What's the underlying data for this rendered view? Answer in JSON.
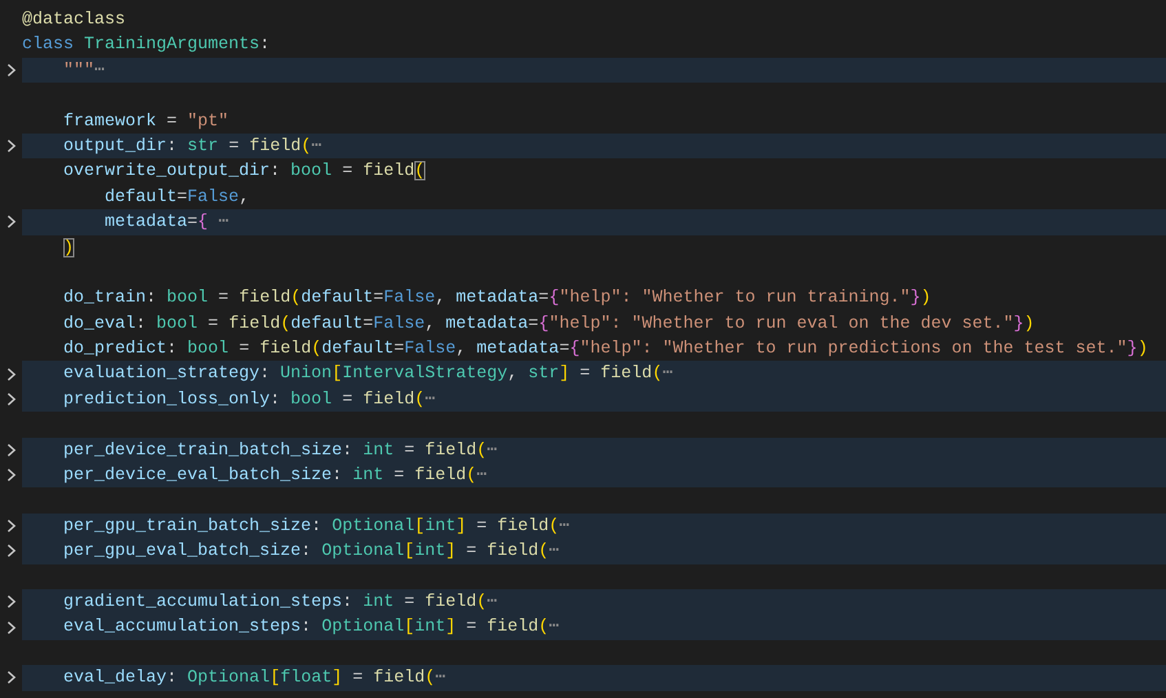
{
  "editor": {
    "blocks": [
      {
        "lines": [
          {
            "folded": false,
            "tokens": [
              {
                "t": "@dataclass",
                "kind": "decorator"
              }
            ]
          },
          {
            "folded": false,
            "tokens": [
              {
                "t": "class ",
                "kind": "keyword"
              },
              {
                "t": "TrainingArguments",
                "kind": "class"
              },
              {
                "t": ":",
                "kind": "plain"
              }
            ]
          },
          {
            "folded": true,
            "tokens": [
              {
                "t": "    \"\"\"",
                "kind": "string"
              },
              {
                "t": "⋯",
                "kind": "fold"
              }
            ]
          }
        ]
      },
      {
        "lines": [
          {
            "folded": false,
            "tokens": [
              {
                "t": "    framework",
                "kind": "var"
              },
              {
                "t": " = ",
                "kind": "plain"
              },
              {
                "t": "\"pt\"",
                "kind": "string"
              }
            ]
          },
          {
            "folded": true,
            "tokens": [
              {
                "t": "    output_dir",
                "kind": "var"
              },
              {
                "t": ": ",
                "kind": "plain"
              },
              {
                "t": "str",
                "kind": "type"
              },
              {
                "t": " = ",
                "kind": "plain"
              },
              {
                "t": "field",
                "kind": "func"
              },
              {
                "t": "(",
                "kind": "bracket1"
              },
              {
                "t": "⋯",
                "kind": "fold"
              }
            ]
          },
          {
            "folded": false,
            "tokens": [
              {
                "t": "    overwrite_output_dir",
                "kind": "var"
              },
              {
                "t": ": ",
                "kind": "plain"
              },
              {
                "t": "bool",
                "kind": "type"
              },
              {
                "t": " = ",
                "kind": "plain"
              },
              {
                "t": "field",
                "kind": "func"
              },
              {
                "t": "(",
                "kind": "bracket1",
                "matched": true
              }
            ]
          },
          {
            "folded": false,
            "tokens": [
              {
                "t": "        default",
                "kind": "var"
              },
              {
                "t": "=",
                "kind": "plain"
              },
              {
                "t": "False",
                "kind": "keyword"
              },
              {
                "t": ",",
                "kind": "plain"
              }
            ]
          },
          {
            "folded": true,
            "tokens": [
              {
                "t": "        metadata",
                "kind": "var"
              },
              {
                "t": "=",
                "kind": "plain"
              },
              {
                "t": "{",
                "kind": "bracket2"
              },
              {
                "t": " ⋯",
                "kind": "fold"
              }
            ]
          },
          {
            "folded": false,
            "tokens": [
              {
                "t": "    )",
                "kind": "bracket1",
                "matched": true
              }
            ]
          }
        ]
      },
      {
        "lines": [
          {
            "folded": false,
            "tokens": [
              {
                "t": "    do_train",
                "kind": "var"
              },
              {
                "t": ": ",
                "kind": "plain"
              },
              {
                "t": "bool",
                "kind": "type"
              },
              {
                "t": " = ",
                "kind": "plain"
              },
              {
                "t": "field",
                "kind": "func"
              },
              {
                "t": "(",
                "kind": "bracket1"
              },
              {
                "t": "default",
                "kind": "var"
              },
              {
                "t": "=",
                "kind": "plain"
              },
              {
                "t": "False",
                "kind": "keyword"
              },
              {
                "t": ", ",
                "kind": "plain"
              },
              {
                "t": "metadata",
                "kind": "var"
              },
              {
                "t": "=",
                "kind": "plain"
              },
              {
                "t": "{",
                "kind": "bracket2"
              },
              {
                "t": "\"help\": \"Whether to run training.\"",
                "kind": "string"
              },
              {
                "t": "}",
                "kind": "bracket2"
              },
              {
                "t": ")",
                "kind": "bracket1"
              }
            ]
          },
          {
            "folded": false,
            "tokens": [
              {
                "t": "    do_eval",
                "kind": "var"
              },
              {
                "t": ": ",
                "kind": "plain"
              },
              {
                "t": "bool",
                "kind": "type"
              },
              {
                "t": " = ",
                "kind": "plain"
              },
              {
                "t": "field",
                "kind": "func"
              },
              {
                "t": "(",
                "kind": "bracket1"
              },
              {
                "t": "default",
                "kind": "var"
              },
              {
                "t": "=",
                "kind": "plain"
              },
              {
                "t": "False",
                "kind": "keyword"
              },
              {
                "t": ", ",
                "kind": "plain"
              },
              {
                "t": "metadata",
                "kind": "var"
              },
              {
                "t": "=",
                "kind": "plain"
              },
              {
                "t": "{",
                "kind": "bracket2"
              },
              {
                "t": "\"help\": \"Whether to run eval on the dev set.\"",
                "kind": "string"
              },
              {
                "t": "}",
                "kind": "bracket2"
              },
              {
                "t": ")",
                "kind": "bracket1"
              }
            ]
          },
          {
            "folded": false,
            "tokens": [
              {
                "t": "    do_predict",
                "kind": "var"
              },
              {
                "t": ": ",
                "kind": "plain"
              },
              {
                "t": "bool",
                "kind": "type"
              },
              {
                "t": " = ",
                "kind": "plain"
              },
              {
                "t": "field",
                "kind": "func"
              },
              {
                "t": "(",
                "kind": "bracket1"
              },
              {
                "t": "default",
                "kind": "var"
              },
              {
                "t": "=",
                "kind": "plain"
              },
              {
                "t": "False",
                "kind": "keyword"
              },
              {
                "t": ", ",
                "kind": "plain"
              },
              {
                "t": "metadata",
                "kind": "var"
              },
              {
                "t": "=",
                "kind": "plain"
              },
              {
                "t": "{",
                "kind": "bracket2"
              },
              {
                "t": "\"help\": \"Whether to run predictions on the test set.\"",
                "kind": "string"
              },
              {
                "t": "}",
                "kind": "bracket2"
              },
              {
                "t": ")",
                "kind": "bracket1"
              }
            ]
          },
          {
            "folded": true,
            "tokens": [
              {
                "t": "    evaluation_strategy",
                "kind": "var"
              },
              {
                "t": ": ",
                "kind": "plain"
              },
              {
                "t": "Union",
                "kind": "type"
              },
              {
                "t": "[",
                "kind": "bracket1"
              },
              {
                "t": "IntervalStrategy",
                "kind": "type"
              },
              {
                "t": ", ",
                "kind": "plain"
              },
              {
                "t": "str",
                "kind": "type"
              },
              {
                "t": "]",
                "kind": "bracket1"
              },
              {
                "t": " = ",
                "kind": "plain"
              },
              {
                "t": "field",
                "kind": "func"
              },
              {
                "t": "(",
                "kind": "bracket1"
              },
              {
                "t": "⋯",
                "kind": "fold"
              }
            ]
          },
          {
            "folded": true,
            "tokens": [
              {
                "t": "    prediction_loss_only",
                "kind": "var"
              },
              {
                "t": ": ",
                "kind": "plain"
              },
              {
                "t": "bool",
                "kind": "type"
              },
              {
                "t": " = ",
                "kind": "plain"
              },
              {
                "t": "field",
                "kind": "func"
              },
              {
                "t": "(",
                "kind": "bracket1"
              },
              {
                "t": "⋯",
                "kind": "fold"
              }
            ]
          }
        ]
      },
      {
        "lines": [
          {
            "folded": true,
            "tokens": [
              {
                "t": "    per_device_train_batch_size",
                "kind": "var"
              },
              {
                "t": ": ",
                "kind": "plain"
              },
              {
                "t": "int",
                "kind": "type"
              },
              {
                "t": " = ",
                "kind": "plain"
              },
              {
                "t": "field",
                "kind": "func"
              },
              {
                "t": "(",
                "kind": "bracket1"
              },
              {
                "t": "⋯",
                "kind": "fold"
              }
            ]
          },
          {
            "folded": true,
            "tokens": [
              {
                "t": "    per_device_eval_batch_size",
                "kind": "var"
              },
              {
                "t": ": ",
                "kind": "plain"
              },
              {
                "t": "int",
                "kind": "type"
              },
              {
                "t": " = ",
                "kind": "plain"
              },
              {
                "t": "field",
                "kind": "func"
              },
              {
                "t": "(",
                "kind": "bracket1"
              },
              {
                "t": "⋯",
                "kind": "fold"
              }
            ]
          }
        ]
      },
      {
        "lines": [
          {
            "folded": true,
            "tokens": [
              {
                "t": "    per_gpu_train_batch_size",
                "kind": "var"
              },
              {
                "t": ": ",
                "kind": "plain"
              },
              {
                "t": "Optional",
                "kind": "type"
              },
              {
                "t": "[",
                "kind": "bracket1"
              },
              {
                "t": "int",
                "kind": "type"
              },
              {
                "t": "]",
                "kind": "bracket1"
              },
              {
                "t": " = ",
                "kind": "plain"
              },
              {
                "t": "field",
                "kind": "func"
              },
              {
                "t": "(",
                "kind": "bracket1"
              },
              {
                "t": "⋯",
                "kind": "fold"
              }
            ]
          },
          {
            "folded": true,
            "tokens": [
              {
                "t": "    per_gpu_eval_batch_size",
                "kind": "var"
              },
              {
                "t": ": ",
                "kind": "plain"
              },
              {
                "t": "Optional",
                "kind": "type"
              },
              {
                "t": "[",
                "kind": "bracket1"
              },
              {
                "t": "int",
                "kind": "type"
              },
              {
                "t": "]",
                "kind": "bracket1"
              },
              {
                "t": " = ",
                "kind": "plain"
              },
              {
                "t": "field",
                "kind": "func"
              },
              {
                "t": "(",
                "kind": "bracket1"
              },
              {
                "t": "⋯",
                "kind": "fold"
              }
            ]
          }
        ]
      },
      {
        "lines": [
          {
            "folded": true,
            "tokens": [
              {
                "t": "    gradient_accumulation_steps",
                "kind": "var"
              },
              {
                "t": ": ",
                "kind": "plain"
              },
              {
                "t": "int",
                "kind": "type"
              },
              {
                "t": " = ",
                "kind": "plain"
              },
              {
                "t": "field",
                "kind": "func"
              },
              {
                "t": "(",
                "kind": "bracket1"
              },
              {
                "t": "⋯",
                "kind": "fold"
              }
            ]
          },
          {
            "folded": true,
            "tokens": [
              {
                "t": "    eval_accumulation_steps",
                "kind": "var"
              },
              {
                "t": ": ",
                "kind": "plain"
              },
              {
                "t": "Optional",
                "kind": "type"
              },
              {
                "t": "[",
                "kind": "bracket1"
              },
              {
                "t": "int",
                "kind": "type"
              },
              {
                "t": "]",
                "kind": "bracket1"
              },
              {
                "t": " = ",
                "kind": "plain"
              },
              {
                "t": "field",
                "kind": "func"
              },
              {
                "t": "(",
                "kind": "bracket1"
              },
              {
                "t": "⋯",
                "kind": "fold"
              }
            ]
          }
        ]
      },
      {
        "lines": [
          {
            "folded": true,
            "tokens": [
              {
                "t": "    eval_delay",
                "kind": "var"
              },
              {
                "t": ": ",
                "kind": "plain"
              },
              {
                "t": "Optional",
                "kind": "type"
              },
              {
                "t": "[",
                "kind": "bracket1"
              },
              {
                "t": "float",
                "kind": "type"
              },
              {
                "t": "]",
                "kind": "bracket1"
              },
              {
                "t": " = ",
                "kind": "plain"
              },
              {
                "t": "field",
                "kind": "func"
              },
              {
                "t": "(",
                "kind": "bracket1"
              },
              {
                "t": "⋯",
                "kind": "fold"
              }
            ]
          }
        ]
      }
    ]
  }
}
